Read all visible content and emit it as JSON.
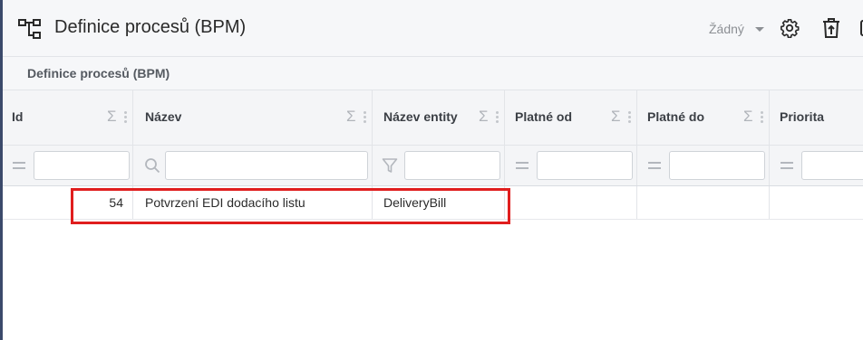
{
  "app": {
    "title": "Definice procesů (BPM)",
    "state_select": "Žádný",
    "title_icon": "process-flow-icon",
    "settings_icon": "gear-icon",
    "delete_icon": "trash-icon"
  },
  "grid": {
    "caption": "Definice procesů (BPM)",
    "columns": [
      {
        "label": "Id",
        "filter_icon": "equals-icon"
      },
      {
        "label": "Název",
        "filter_icon": "search-icon"
      },
      {
        "label": "Název entity",
        "filter_icon": "funnel-icon"
      },
      {
        "label": "Platné od",
        "filter_icon": "equals-icon"
      },
      {
        "label": "Platné do",
        "filter_icon": "equals-icon"
      },
      {
        "label": "Priorita",
        "filter_icon": "equals-icon"
      }
    ],
    "sum_symbol": "Σ",
    "rows": [
      {
        "id": "54",
        "name": "Potvrzení EDI dodacího listu",
        "entity": "DeliveryBill",
        "valid_from": "",
        "valid_to": "",
        "priority": ""
      }
    ]
  },
  "colors": {
    "highlight": "#e01e1e",
    "header_bg": "#f4f5f7"
  }
}
